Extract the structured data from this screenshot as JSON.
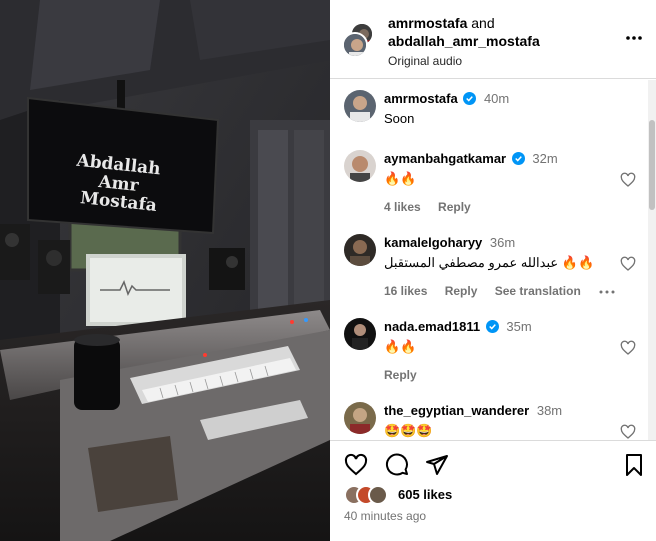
{
  "media": {
    "screen_text_line1": "Abdallah",
    "screen_text_line2": "Amr",
    "screen_text_line3": "Mostafa"
  },
  "header": {
    "user1": "amrmostafa",
    "and": "and",
    "user2": "abdallah_amr_mostafa",
    "audio": "Original audio"
  },
  "comments": [
    {
      "user": "amrmostafa",
      "verified": true,
      "time": "40m",
      "text": "Soon",
      "likes": "",
      "reply": "",
      "translation": ""
    },
    {
      "user": "aymanbahgatkamar",
      "verified": true,
      "time": "32m",
      "text": "🔥🔥",
      "likes": "4 likes",
      "reply": "Reply",
      "translation": ""
    },
    {
      "user": "kamalelgoharyy",
      "verified": false,
      "time": "36m",
      "text": "عبدالله عمرو مصطفي المستقبل 🔥🔥",
      "likes": "16 likes",
      "reply": "Reply",
      "translation": "See translation"
    },
    {
      "user": "nada.emad1811",
      "verified": true,
      "time": "35m",
      "text": "🔥🔥",
      "likes": "",
      "reply": "Reply",
      "translation": ""
    },
    {
      "user": "the_egyptian_wanderer",
      "verified": false,
      "time": "38m",
      "text": "🤩🤩🤩",
      "likes": "",
      "reply": "",
      "translation": ""
    }
  ],
  "footer": {
    "likes": "605 likes",
    "time": "40 minutes ago"
  },
  "icons": [
    "more-icon",
    "heart-icon",
    "comment-icon",
    "share-icon",
    "save-icon",
    "verified-icon"
  ],
  "colors": {
    "verified": "#0095f6",
    "muted": "#737373",
    "border": "#dbdbdb"
  }
}
